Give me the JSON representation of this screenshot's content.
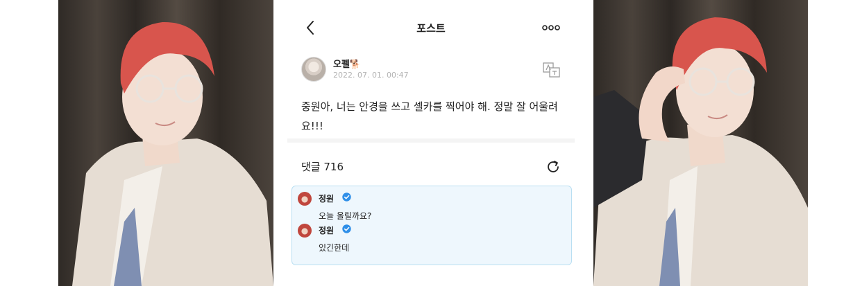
{
  "header": {
    "title": "포스트",
    "back_icon": "chevron-left-icon",
    "more_icon": "more-dots-icon"
  },
  "post": {
    "author_name": "오펠🐕",
    "date": "2022. 07. 01. 00:47",
    "content": "중원아, 너는 안경을 쓰고 셀카를 찍어야 해. 정말 잘 어울려요!!!",
    "translate_icon": "translate-icon"
  },
  "comments": {
    "label": "댓글 716",
    "refresh_icon": "refresh-icon",
    "replies": [
      {
        "name": "정원",
        "text": "오늘 올릴까요?",
        "verified": true
      },
      {
        "name": "정원",
        "text": "있긴한데",
        "verified": true
      }
    ]
  },
  "colors": {
    "accent_blue": "#2f8fe8",
    "reply_bg": "#eef7fd",
    "reply_border": "#b9dff2",
    "hair": "#d8554d"
  }
}
